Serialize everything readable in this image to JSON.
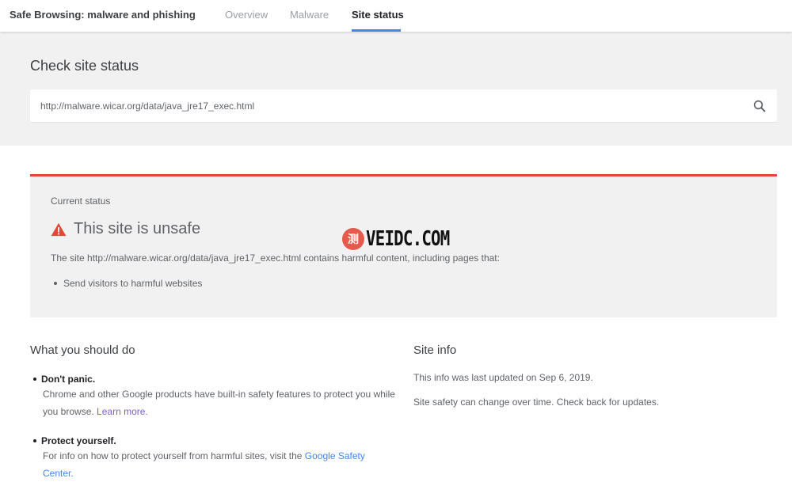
{
  "header": {
    "app_title": "Safe Browsing: malware and phishing",
    "tabs": [
      {
        "label": "Overview",
        "active": false
      },
      {
        "label": "Malware",
        "active": false
      },
      {
        "label": "Site status",
        "active": true
      }
    ]
  },
  "search": {
    "title": "Check site status",
    "value": "http://malware.wicar.org/data/java_jre17_exec.html",
    "icon": "search-icon"
  },
  "status": {
    "label": "Current status",
    "heading": "This site is unsafe",
    "icon": "warning-icon",
    "description": "The site http://malware.wicar.org/data/java_jre17_exec.html contains harmful content, including pages that:",
    "bullets": [
      "Send visitors to harmful websites"
    ],
    "accent_color": "#e5463a"
  },
  "watermark": {
    "badge": "测",
    "text": "VEIDC.COM"
  },
  "todo": {
    "title": "What you should do",
    "items": [
      {
        "heading": "Don't panic.",
        "body": "Chrome and other Google products have built-in safety features to protect you while you browse. ",
        "link": "Learn more."
      },
      {
        "heading": "Protect yourself.",
        "body": "For info on how to protect yourself from harmful sites, visit the ",
        "link": "Google Safety Center."
      }
    ]
  },
  "site_info": {
    "title": "Site info",
    "lines": [
      "This info was last updated on Sep 6, 2019.",
      "Site safety can change over time. Check back for updates."
    ]
  },
  "colors": {
    "tab_active_underline": "#4285f4",
    "link": "#4285f4",
    "panel_bg": "#f1f1f1"
  }
}
